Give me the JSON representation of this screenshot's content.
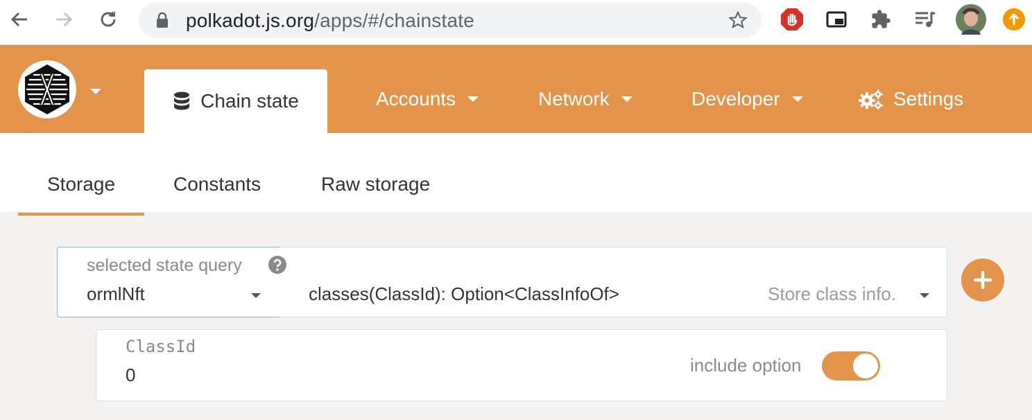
{
  "browser": {
    "url_host": "polkadot.js.org",
    "url_path": "/apps/#/chainstate"
  },
  "header": {
    "active_tab": "Chain state",
    "menu": [
      {
        "label": "Accounts"
      },
      {
        "label": "Network"
      },
      {
        "label": "Developer"
      },
      {
        "label": "Settings"
      }
    ]
  },
  "subnav": {
    "tabs": [
      {
        "label": "Storage"
      },
      {
        "label": "Constants"
      },
      {
        "label": "Raw storage"
      }
    ]
  },
  "query": {
    "label": "selected state query",
    "section": "ormlNft",
    "method": "classes(ClassId): Option<ClassInfoOf>",
    "description": "Store class info."
  },
  "param": {
    "label": "ClassId",
    "value": "0",
    "toggle_label": "include option"
  },
  "colors": {
    "accent": "#e4944a",
    "header_bg": "#e4944a",
    "page_bg": "#f4f3f2"
  }
}
